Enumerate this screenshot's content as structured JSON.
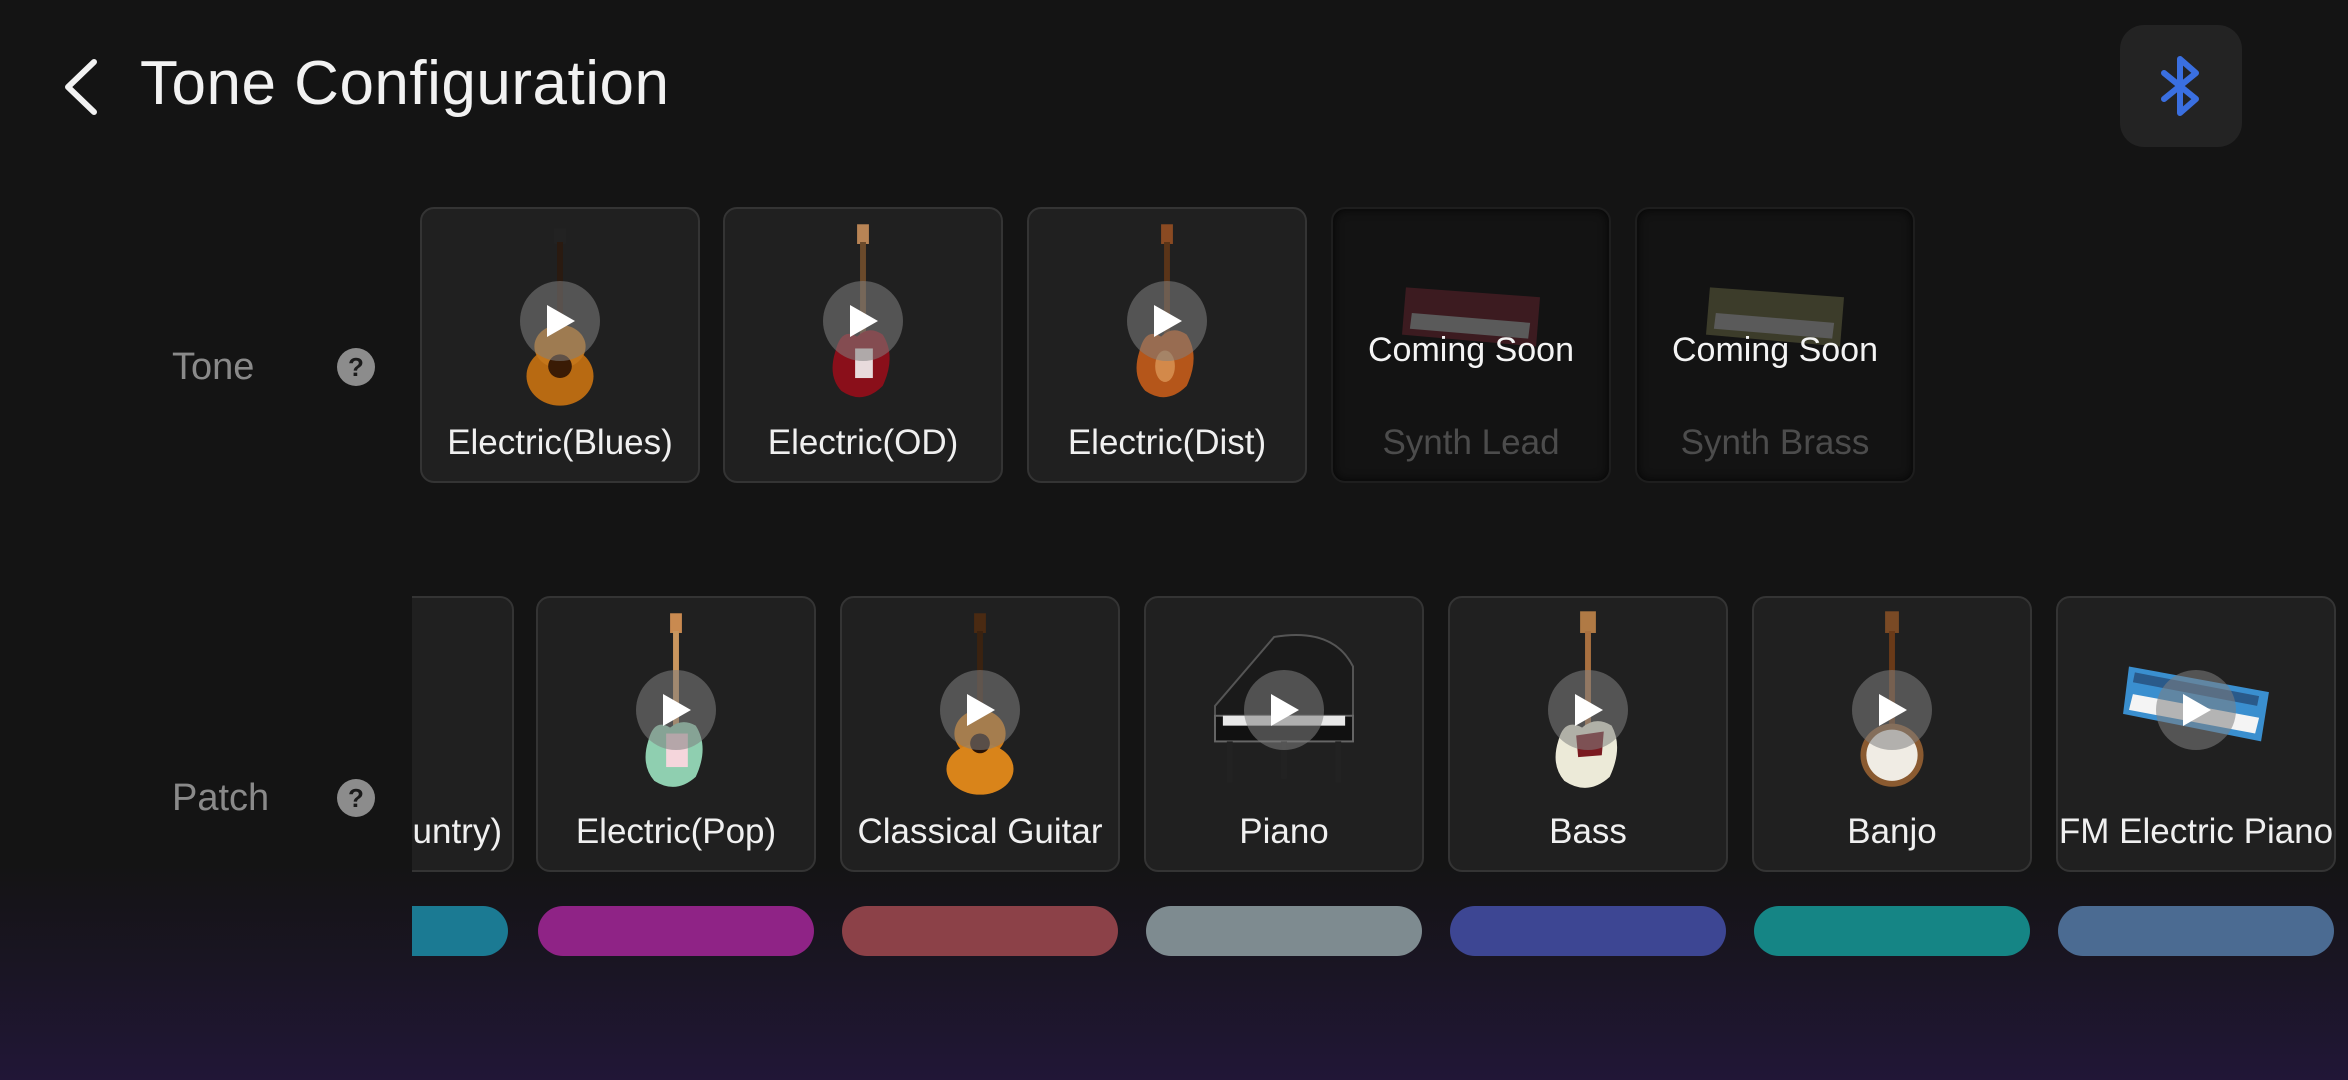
{
  "header": {
    "title": "Tone Configuration"
  },
  "colors": {
    "bluetooth": "#3a6fe0"
  },
  "tone": {
    "label": "Tone",
    "cards": [
      {
        "label": "Electric(Blues)",
        "icon": "hollow-body-guitar"
      },
      {
        "label": "Electric(OD)",
        "icon": "red-electric-guitar"
      },
      {
        "label": "Electric(Dist)",
        "icon": "sunburst-electric-guitar"
      },
      {
        "label": "Synth Lead",
        "badge": "Coming Soon",
        "icon": "synth-keyboard"
      },
      {
        "label": "Synth Brass",
        "badge": "Coming Soon",
        "icon": "synth-keyboard"
      }
    ]
  },
  "patch": {
    "label": "Patch",
    "cards": [
      {
        "label": "untry)",
        "color": "#1b7a93"
      },
      {
        "label": "Electric(Pop)",
        "color": "#8f2386"
      },
      {
        "label": "Classical Guitar",
        "color": "#8c4148"
      },
      {
        "label": "Piano",
        "color": "#7e8b90"
      },
      {
        "label": "Bass",
        "color": "#3d4693"
      },
      {
        "label": "Banjo",
        "color": "#158585"
      },
      {
        "label": "FM Electric Piano",
        "color": "#4b6b92"
      }
    ]
  }
}
